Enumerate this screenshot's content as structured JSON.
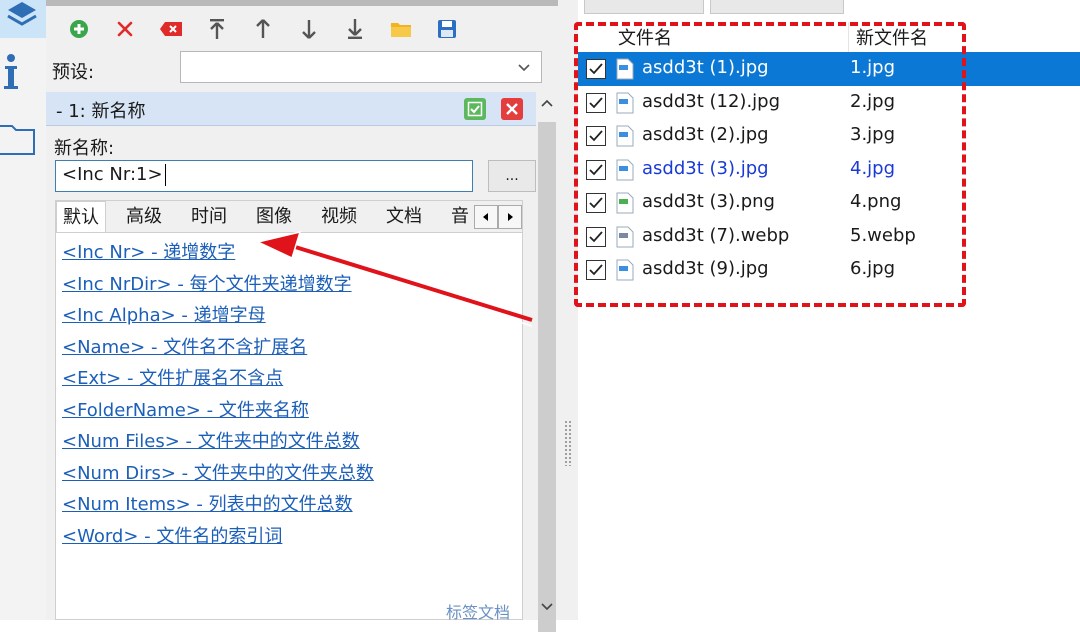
{
  "toolbar": {
    "buttons": [
      {
        "name": "add-rule-button",
        "icon": "plus-circle-icon"
      },
      {
        "name": "delete-rule-button",
        "icon": "x-icon"
      },
      {
        "name": "clear-rules-button",
        "icon": "eraser-icon"
      },
      {
        "name": "move-top-button",
        "icon": "move-top-icon"
      },
      {
        "name": "move-up-button",
        "icon": "arrow-up-icon"
      },
      {
        "name": "move-down-button",
        "icon": "arrow-down-icon"
      },
      {
        "name": "move-bottom-button",
        "icon": "move-bottom-icon"
      },
      {
        "name": "open-folder-button",
        "icon": "folder-icon"
      },
      {
        "name": "save-button",
        "icon": "floppy-disk-icon"
      }
    ]
  },
  "preset": {
    "label": "预设:",
    "value": ""
  },
  "rule": {
    "header": "-  1: 新名称"
  },
  "newname": {
    "label": "新名称:",
    "value": "<Inc Nr:1>",
    "browse_label": "..."
  },
  "tabs": [
    "默认",
    "高级",
    "时间",
    "图像",
    "视频",
    "文档",
    "音"
  ],
  "tags": [
    "<Inc Nr> - 递增数字",
    "<Inc NrDir> - 每个文件夹递增数字",
    "<Inc Alpha> - 递增字母",
    "<Name> - 文件名不含扩展名",
    "<Ext> - 文件扩展名不含点",
    "<FolderName> - 文件夹名称",
    "<Num Files> - 文件夹中的文件总数",
    "<Num Dirs> - 文件夹中的文件夹总数",
    "<Num Items> - 列表中的文件总数",
    "<Word> - 文件名的索引词"
  ],
  "tags_footer": "标签文档",
  "filelist": {
    "col_name": "文件名",
    "col_newname": "新文件名",
    "rows": [
      {
        "name": "asdd3t (1).jpg",
        "new": "1.jpg",
        "checked": true,
        "selected": true
      },
      {
        "name": "asdd3t (12).jpg",
        "new": "2.jpg",
        "checked": true
      },
      {
        "name": "asdd3t (2).jpg",
        "new": "3.jpg",
        "checked": true
      },
      {
        "name": "asdd3t (3).jpg",
        "new": "4.jpg",
        "checked": true,
        "highlight": "blue"
      },
      {
        "name": "asdd3t (3).png",
        "new": "4.png",
        "checked": true
      },
      {
        "name": "asdd3t (7).webp",
        "new": "5.webp",
        "checked": true
      },
      {
        "name": "asdd3t (9).jpg",
        "new": "6.jpg",
        "checked": true
      }
    ]
  },
  "colors": {
    "accent": "#0a78d4",
    "annotation": "#e0121a",
    "link": "#1c5fb8",
    "conflict": "#1a3ad6"
  }
}
